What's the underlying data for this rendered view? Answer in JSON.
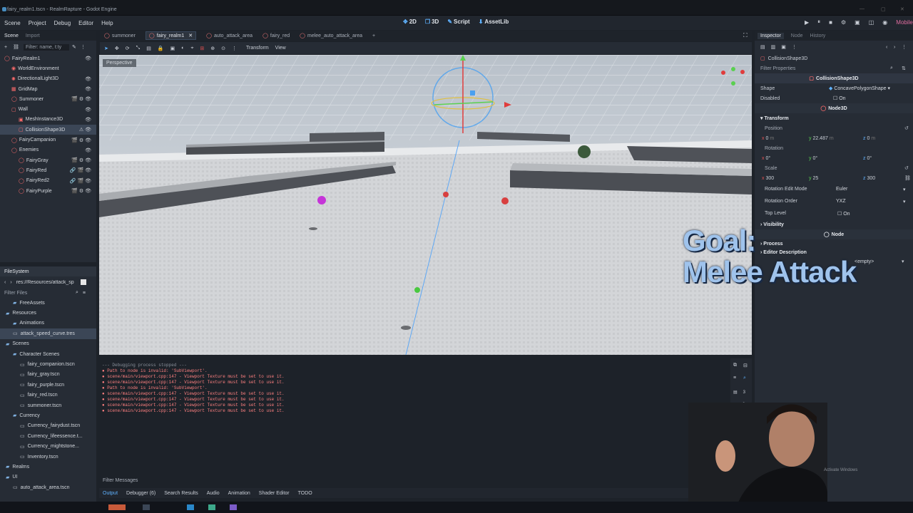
{
  "window": {
    "title": "fairy_realm1.tscn - RealmRapture - Godot Engine"
  },
  "menu": [
    "Scene",
    "Project",
    "Debug",
    "Editor",
    "Help"
  ],
  "workspaces": [
    {
      "icon": "✥",
      "label": "2D"
    },
    {
      "icon": "❒",
      "label": "3D"
    },
    {
      "icon": "✎",
      "label": "Script"
    },
    {
      "icon": "⬇",
      "label": "AssetLib"
    }
  ],
  "renderer": "Mobile",
  "scene_dock": {
    "tabs": [
      "Scene",
      "Import"
    ],
    "filter_placeholder": "Filter: name, t:ty",
    "nodes": [
      {
        "label": "FairyRealm1",
        "depth": 0,
        "icon": "◯",
        "eye": "👁"
      },
      {
        "label": "WorldEnvironment",
        "depth": 1,
        "icon": "◉",
        "eye": ""
      },
      {
        "label": "DirectionalLight3D",
        "depth": 1,
        "icon": "✺",
        "eye": "👁"
      },
      {
        "label": "GridMap",
        "depth": 1,
        "icon": "▦",
        "eye": "👁"
      },
      {
        "label": "Summoner",
        "depth": 1,
        "icon": "◯",
        "eye": "🎬 ⚙ 👁"
      },
      {
        "label": "Wall",
        "depth": 1,
        "icon": "▢",
        "eye": "👁"
      },
      {
        "label": "MeshInstance3D",
        "depth": 2,
        "icon": "▣",
        "eye": "👁"
      },
      {
        "label": "CollisionShape3D",
        "depth": 2,
        "icon": "▢",
        "eye": "⚠ 👁",
        "sel": true
      },
      {
        "label": "FairyCampanion",
        "depth": 1,
        "icon": "◯",
        "eye": "🎬 ⚙ 👁"
      },
      {
        "label": "Enemies",
        "depth": 1,
        "icon": "◯",
        "eye": "👁"
      },
      {
        "label": "FairyGray",
        "depth": 2,
        "icon": "◯",
        "eye": "🎬 ⚙ 👁"
      },
      {
        "label": "FairyRed",
        "depth": 2,
        "icon": "◯",
        "eye": "🔗 🎬 👁"
      },
      {
        "label": "FairyRed2",
        "depth": 2,
        "icon": "◯",
        "eye": "🔗 🎬 👁"
      },
      {
        "label": "FairyPurple",
        "depth": 2,
        "icon": "◯",
        "eye": "🎬 ⚙ 👁"
      }
    ]
  },
  "filesystem": {
    "title": "FileSystem",
    "path": "res://Resources/attack_sp",
    "filter_placeholder": "Filter Files",
    "items": [
      {
        "label": "FreeAssets",
        "depth": 1,
        "folder": true
      },
      {
        "label": "Resources",
        "depth": 0,
        "folder": true
      },
      {
        "label": "Animations",
        "depth": 1,
        "folder": true
      },
      {
        "label": "attack_speed_curve.tres",
        "depth": 1,
        "folder": false,
        "sel": true
      },
      {
        "label": "Scenes",
        "depth": 0,
        "folder": true
      },
      {
        "label": "Character Scenes",
        "depth": 1,
        "folder": true
      },
      {
        "label": "fairy_companion.tscn",
        "depth": 2,
        "folder": false
      },
      {
        "label": "fairy_gray.tscn",
        "depth": 2,
        "folder": false
      },
      {
        "label": "fairy_purple.tscn",
        "depth": 2,
        "folder": false
      },
      {
        "label": "fairy_red.tscn",
        "depth": 2,
        "folder": false
      },
      {
        "label": "summoner.tscn",
        "depth": 2,
        "folder": false
      },
      {
        "label": "Currency",
        "depth": 1,
        "folder": true
      },
      {
        "label": "Currency_fairydust.tscn",
        "depth": 2,
        "folder": false
      },
      {
        "label": "Currency_lifeessence.t...",
        "depth": 2,
        "folder": false
      },
      {
        "label": "Currency_mightstone...",
        "depth": 2,
        "folder": false
      },
      {
        "label": "Inventory.tscn",
        "depth": 2,
        "folder": false
      },
      {
        "label": "Realms",
        "depth": 0,
        "folder": true
      },
      {
        "label": "UI",
        "depth": 0,
        "folder": true
      },
      {
        "label": "auto_attack_area.tscn",
        "depth": 1,
        "folder": false
      }
    ]
  },
  "editor_tabs": [
    {
      "label": "summoner",
      "active": false
    },
    {
      "label": "fairy_realm1",
      "active": true
    },
    {
      "label": "auto_attack_area",
      "active": false
    },
    {
      "label": "fairy_red",
      "active": false
    },
    {
      "label": "melee_auto_attack_area",
      "active": false
    }
  ],
  "viewport_toolbar": [
    "Transform",
    "View"
  ],
  "viewport": {
    "label": "Perspective"
  },
  "console": {
    "header": "--- Debugging process stopped ---",
    "lines": [
      "Path to node is invalid: 'SubViewport'.",
      "scene/main/viewport.cpp:147 - Viewport Texture must be set to use it.",
      "scene/main/viewport.cpp:147 - Viewport Texture must be set to use it.",
      "Path to node is invalid: 'SubViewport'.",
      "scene/main/viewport.cpp:147 - Viewport Texture must be set to use it.",
      "scene/main/viewport.cpp:147 - Viewport Texture must be set to use it.",
      "scene/main/viewport.cpp:147 - Viewport Texture must be set to use it.",
      "scene/main/viewport.cpp:147 - Viewport Texture must be set to use it."
    ],
    "counts": {
      "messages": "3",
      "errors": "8",
      "warnings": "0",
      "info": "1"
    },
    "filter_placeholder": "Filter Messages"
  },
  "bottom_tabs": [
    {
      "label": "Output",
      "active": true
    },
    {
      "label": "Debugger (6)",
      "active": false
    },
    {
      "label": "Search Results",
      "active": false
    },
    {
      "label": "Audio",
      "active": false
    },
    {
      "label": "Animation",
      "active": false
    },
    {
      "label": "Shader Editor",
      "active": false
    },
    {
      "label": "TODO",
      "active": false
    }
  ],
  "inspector": {
    "tabs": [
      "Inspector",
      "Node",
      "History"
    ],
    "object": "CollisionShape3D",
    "filter_placeholder": "Filter Properties",
    "class_header": "CollisionShape3D",
    "shape_label": "Shape",
    "shape_value": "ConcavePolygonShape",
    "disabled_label": "Disabled",
    "disabled_value": "On",
    "node3d_header": "Node3D",
    "transform_header": "Transform",
    "position_label": "Position",
    "position": {
      "x": "0",
      "y": "22.487",
      "z": "0",
      "unit": "m"
    },
    "rotation_label": "Rotation",
    "rotation": {
      "x": "0",
      "y": "0",
      "z": "0"
    },
    "scale_label": "Scale",
    "scale": {
      "x": "300",
      "y": "25",
      "z": "300"
    },
    "rot_edit_label": "Rotation Edit Mode",
    "rot_edit_value": "Euler",
    "rot_order_label": "Rotation Order",
    "rot_order_value": "YXZ",
    "top_level_label": "Top Level",
    "top_level_value": "On",
    "visibility": "Visibility",
    "node_header": "Node",
    "process": "Process",
    "editor_desc": "Editor Description",
    "empty": "<empty>"
  },
  "overlay": {
    "line1": "Goal:",
    "line2": "Melee Attack"
  },
  "watermark": "Activate Windows"
}
